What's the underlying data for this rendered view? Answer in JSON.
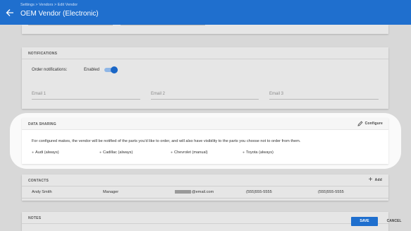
{
  "header": {
    "breadcrumb": "Settings > Vendors > Edit Vendor",
    "title": "OEM Vendor (Electronic)",
    "back_icon": "arrow-left-icon"
  },
  "notifications": {
    "heading": "NOTIFICATIONS",
    "order_label": "Order notifications:",
    "order_state": "Enabled",
    "order_enabled": true,
    "email_placeholders": [
      "Email 1",
      "Email 2",
      "Email 3"
    ]
  },
  "data_sharing": {
    "heading": "DATA SHARING",
    "configure_label": "Configure",
    "configure_icon": "pencil-icon",
    "description": "For configured makes, the vendor will be notified of the parts you'd like to order, and will also have visibility to the parts you choose not to order from them.",
    "makes": [
      "Audi (always)",
      "Cadillac (always)",
      "Chevrolet (manual)",
      "Toyota (always)"
    ]
  },
  "contacts": {
    "heading": "CONTACTS",
    "add_label": "Add",
    "add_icon": "plus-icon",
    "rows": [
      {
        "name": "Andy Smith",
        "role": "Manager",
        "email": "@email.com",
        "phone1": "(555)555-5555",
        "phone2": "(555)555-5555"
      }
    ]
  },
  "notes": {
    "heading": "NOTES"
  },
  "actions": {
    "save_label": "SAVE",
    "cancel_label": "CANCEL"
  },
  "colors": {
    "primary": "#1f6fce",
    "toggle_on": "#1a66c6",
    "page_bg": "#d8d8d8"
  }
}
